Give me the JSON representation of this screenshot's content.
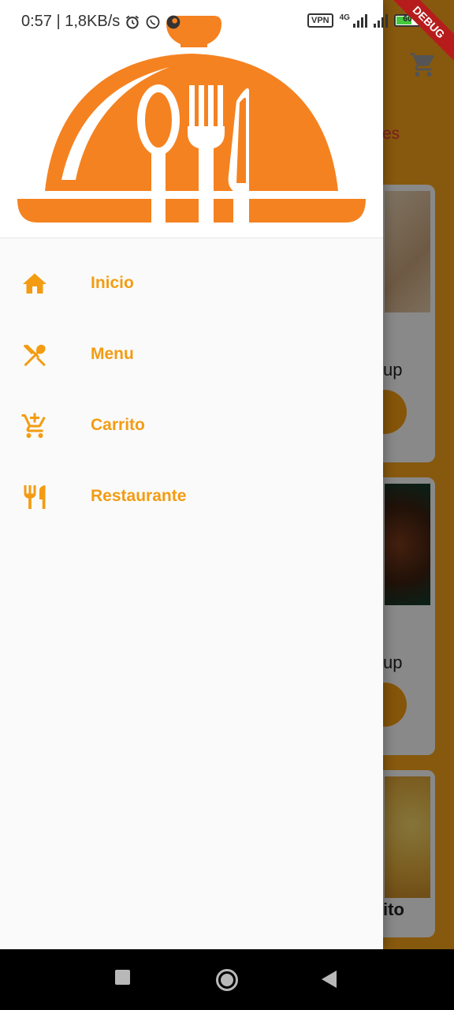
{
  "status_bar": {
    "time": "0:57 | 1,8KB/s",
    "vpn_label": "VPN",
    "network_type": "4G",
    "battery_level": "60"
  },
  "debug_banner": "DEBUG",
  "colors": {
    "accent": "#f39c12",
    "logo_orange": "#f58220",
    "drawer_bg": "#fafafa",
    "nav_bar": "#000000"
  },
  "drawer": {
    "items": [
      {
        "label": "Inicio",
        "icon": "home-icon"
      },
      {
        "label": "Menu",
        "icon": "spoon-fork-icon"
      },
      {
        "label": "Carrito",
        "icon": "cart-add-icon"
      },
      {
        "label": "Restaurante",
        "icon": "restaurant-icon"
      }
    ]
  },
  "background": {
    "tab_fragment": "res",
    "card_labels": [
      "up",
      "up",
      "ito"
    ]
  }
}
